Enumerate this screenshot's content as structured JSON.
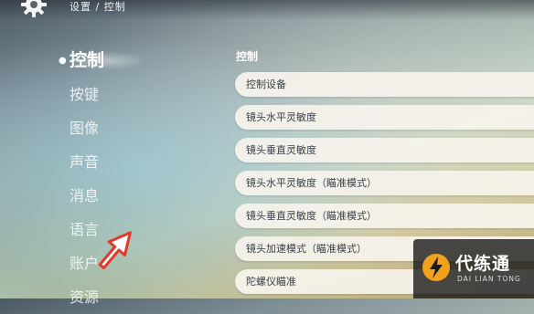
{
  "header": {
    "breadcrumb": "设置 / 控制",
    "icon": "gear-icon"
  },
  "sidebar": {
    "items": [
      {
        "label": "控制",
        "active": true
      },
      {
        "label": "按键"
      },
      {
        "label": "图像"
      },
      {
        "label": "声音"
      },
      {
        "label": "消息"
      },
      {
        "label": "语言"
      },
      {
        "label": "账户"
      },
      {
        "label": "资源"
      }
    ]
  },
  "main": {
    "section_title": "控制",
    "rows": [
      {
        "label": "控制设备"
      },
      {
        "label": "镜头水平灵敏度"
      },
      {
        "label": "镜头垂直灵敏度"
      },
      {
        "label": "镜头水平灵敏度（瞄准模式）"
      },
      {
        "label": "镜头垂直灵敏度（瞄准模式）"
      },
      {
        "label": "镜头加速模式（瞄准模式）"
      },
      {
        "label": "陀螺仪瞄准"
      }
    ]
  },
  "watermark": {
    "title": "代练通",
    "subtitle": "DAI LIAN TONG"
  },
  "colors": {
    "accent": "#f2a11d",
    "arrow_fill": "#ffffff",
    "arrow_stroke": "#e23a2a"
  }
}
